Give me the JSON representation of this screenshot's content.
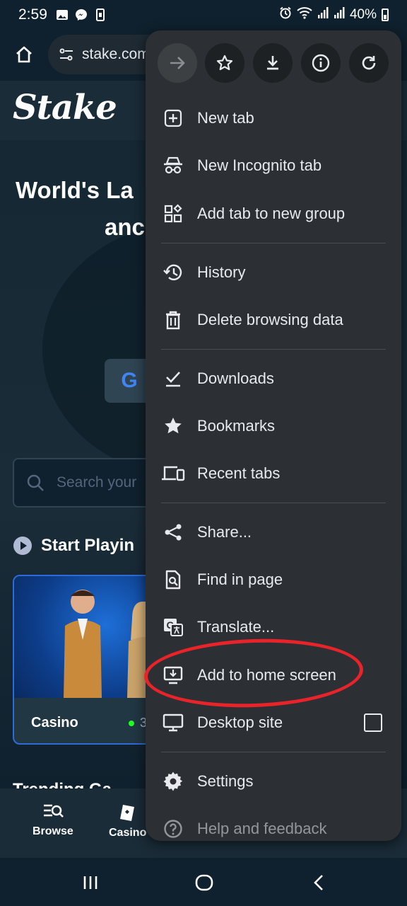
{
  "status_bar": {
    "time": "2:59",
    "battery": "40%",
    "left_icons": [
      "image-icon",
      "messenger-icon",
      "sim-icon"
    ],
    "right_icons": [
      "alarm-icon",
      "wifi-icon",
      "signal-icon",
      "signal-icon",
      "battery-icon"
    ]
  },
  "browser": {
    "url": "stake.com",
    "home_icon": "home-icon",
    "site_settings_icon": "tune-icon"
  },
  "page": {
    "logo": "Stake",
    "hero_line1": "World's La",
    "hero_line2": "anc",
    "google_button": "G",
    "search_placeholder": "Search your",
    "start_playing": "Start Playin",
    "card_label": "Casino",
    "card_online": "3",
    "trending": "Trending Ga"
  },
  "site_nav": {
    "items": [
      {
        "label": "Browse",
        "icon": "browse-icon"
      },
      {
        "label": "Casino",
        "icon": "casino-icon"
      }
    ]
  },
  "menu": {
    "top_buttons": [
      "forward-icon",
      "star-icon",
      "download-icon",
      "info-icon",
      "refresh-icon"
    ],
    "items": [
      {
        "label": "New tab",
        "icon": "plus-box-icon"
      },
      {
        "label": "New Incognito tab",
        "icon": "incognito-icon"
      },
      {
        "label": "Add tab to new group",
        "icon": "tab-group-icon"
      },
      {
        "label": "History",
        "icon": "history-icon"
      },
      {
        "label": "Delete browsing data",
        "icon": "trash-icon"
      },
      {
        "label": "Downloads",
        "icon": "downloads-icon"
      },
      {
        "label": "Bookmarks",
        "icon": "bookmark-star-icon"
      },
      {
        "label": "Recent tabs",
        "icon": "devices-icon"
      },
      {
        "label": "Share...",
        "icon": "share-icon"
      },
      {
        "label": "Find in page",
        "icon": "find-in-page-icon"
      },
      {
        "label": "Translate...",
        "icon": "translate-icon"
      },
      {
        "label": "Add to home screen",
        "icon": "add-to-home-icon"
      },
      {
        "label": "Desktop site",
        "icon": "desktop-icon",
        "checked": false
      },
      {
        "label": "Settings",
        "icon": "gear-icon"
      },
      {
        "label": "Help and feedback",
        "icon": "help-icon"
      }
    ]
  },
  "colors": {
    "page_bg": "#0f212e",
    "menu_bg": "#2c3034",
    "menu_text": "#e8eaed",
    "highlight": "#e8232a",
    "online": "#1fff20"
  }
}
